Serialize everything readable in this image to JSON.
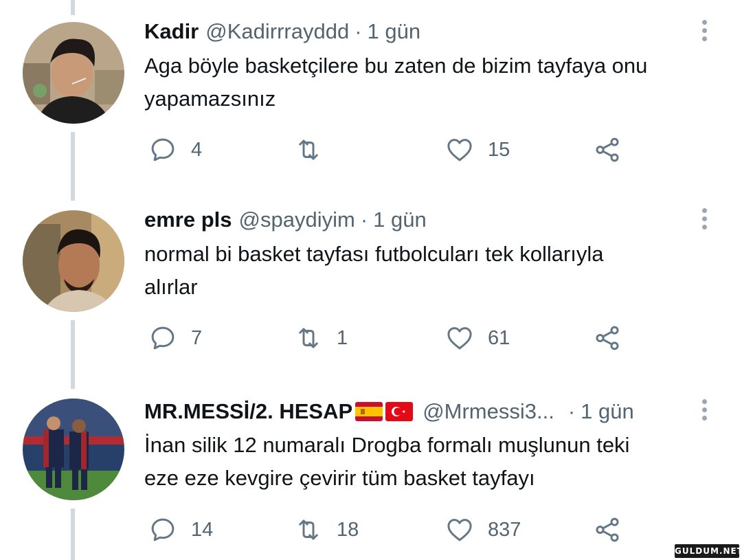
{
  "tweets": [
    {
      "name": "Kadir",
      "handle": "@Kadirrrayddd",
      "dot": "·",
      "time": "1 gün",
      "text_line1": "Aga böyle basketçilere bu zaten de bizim tayfaya onu",
      "text_line2": "yapamazsınız",
      "reply_count": "4",
      "retweet_count": "",
      "like_count": "15"
    },
    {
      "name": "emre pls",
      "handle": "@spaydiyim",
      "dot": "·",
      "time": "1 gün",
      "text_line1": "normal bi basket tayfası futbolcuları tek kollarıyla",
      "text_line2": "alırlar",
      "reply_count": "7",
      "retweet_count": "1",
      "like_count": "61"
    },
    {
      "name": "MR.MESSİ/2. HESAP",
      "flags": [
        "spain-flag",
        "turkey-flag"
      ],
      "handle": "@Mrmessi3...",
      "dot": "·",
      "time": "1 gün",
      "text_line1": "İnan silik 12 numaralı Drogba formalı muşlunun teki",
      "text_line2": "eze eze kevgire çevirir tüm basket tayfayı",
      "reply_count": "14",
      "retweet_count": "18",
      "like_count": "837"
    }
  ],
  "icons": {
    "reply": "reply-icon",
    "retweet": "retweet-icon",
    "like": "heart-icon",
    "share": "share-icon",
    "more": "more-options-icon"
  },
  "colors": {
    "icon": "#657786",
    "secondary_text": "#536471",
    "thread_line": "#cfd9de"
  },
  "watermark": "GULDUM.NET"
}
